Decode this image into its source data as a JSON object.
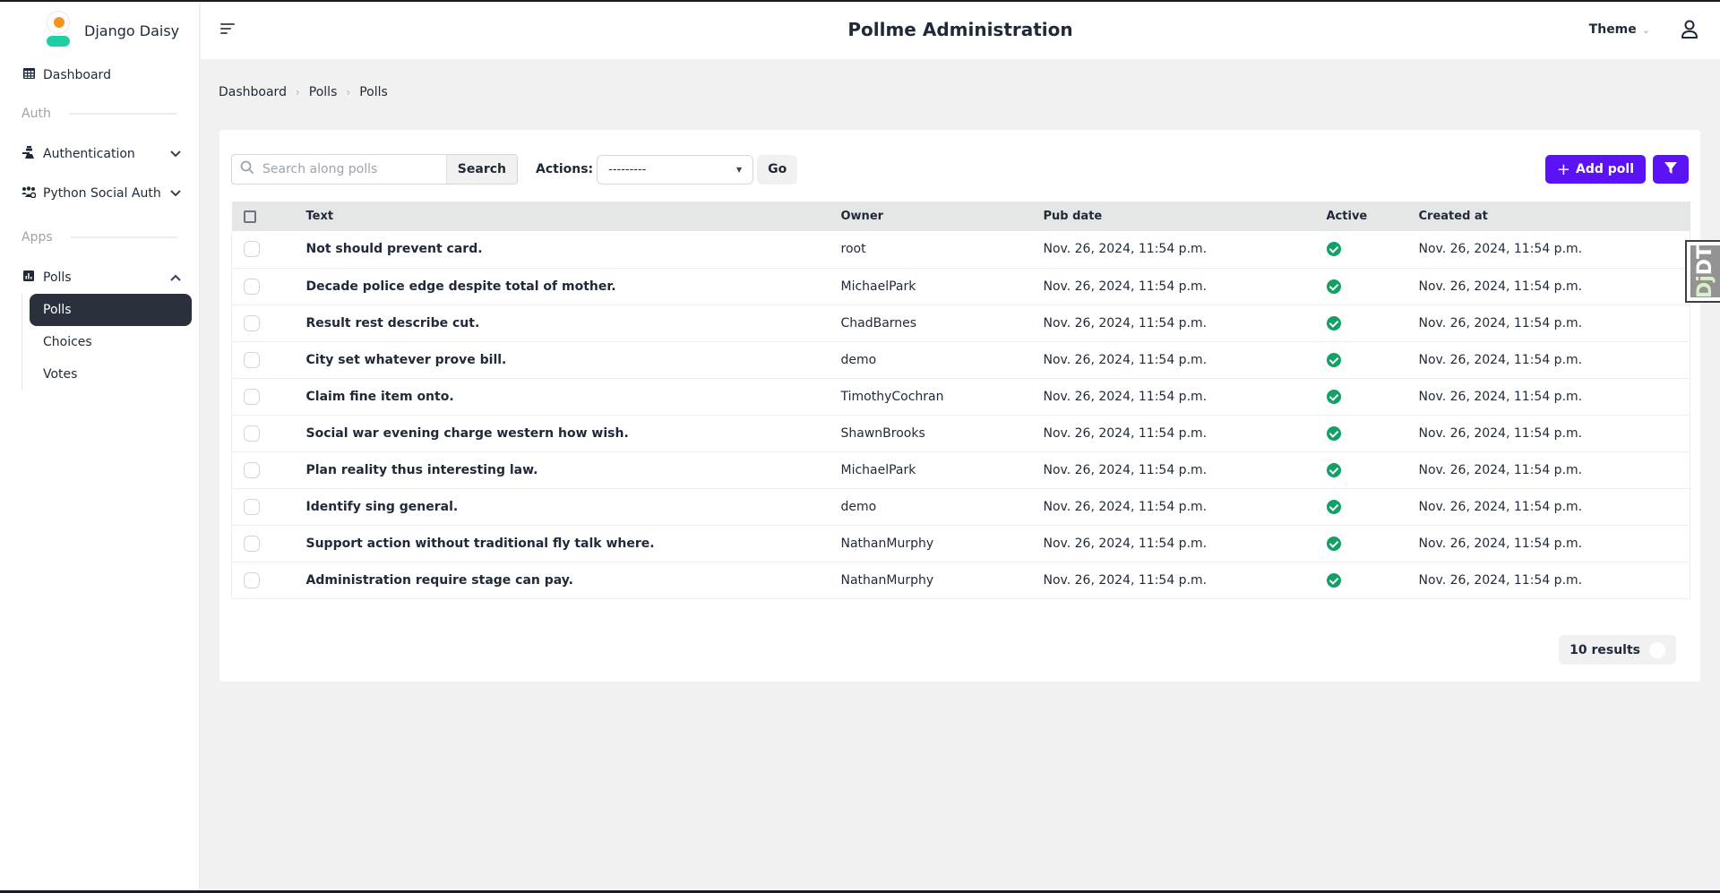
{
  "brand": {
    "name": "Django Daisy",
    "logo_colors": {
      "head": "#f7941d",
      "body": "#1dcfa3"
    }
  },
  "sidebar": {
    "dashboard": {
      "label": "Dashboard",
      "icon": "table-icon"
    },
    "sections": [
      {
        "title": "Auth",
        "items": [
          {
            "label": "Authentication",
            "icon": "user-shield-icon",
            "expanded": false
          },
          {
            "label": "Python Social Auth",
            "icon": "users-gear-icon",
            "expanded": false
          }
        ]
      },
      {
        "title": "Apps",
        "items": [
          {
            "label": "Polls",
            "icon": "chart-icon",
            "expanded": true,
            "children": [
              {
                "label": "Polls",
                "active": true
              },
              {
                "label": "Choices",
                "active": false
              },
              {
                "label": "Votes",
                "active": false
              }
            ]
          }
        ]
      }
    ]
  },
  "header": {
    "title": "Pollme Administration",
    "theme_label": "Theme"
  },
  "breadcrumb": [
    "Dashboard",
    "Polls",
    "Polls"
  ],
  "toolbar": {
    "search_placeholder": "Search along polls",
    "search_value": "",
    "search_button": "Search",
    "actions_label": "Actions:",
    "actions_selected": "---------",
    "go_button": "Go",
    "add_button": "Add poll",
    "accent_color": "#5b12f5"
  },
  "table": {
    "columns": [
      "Text",
      "Owner",
      "Pub date",
      "Active",
      "Created at"
    ],
    "rows": [
      {
        "text": "Not should prevent card.",
        "owner": "root",
        "pub_date": "Nov. 26, 2024, 11:54 p.m.",
        "active": true,
        "created_at": "Nov. 26, 2024, 11:54 p.m."
      },
      {
        "text": "Decade police edge despite total of mother.",
        "owner": "MichaelPark",
        "pub_date": "Nov. 26, 2024, 11:54 p.m.",
        "active": true,
        "created_at": "Nov. 26, 2024, 11:54 p.m."
      },
      {
        "text": "Result rest describe cut.",
        "owner": "ChadBarnes",
        "pub_date": "Nov. 26, 2024, 11:54 p.m.",
        "active": true,
        "created_at": "Nov. 26, 2024, 11:54 p.m."
      },
      {
        "text": "City set whatever prove bill.",
        "owner": "demo",
        "pub_date": "Nov. 26, 2024, 11:54 p.m.",
        "active": true,
        "created_at": "Nov. 26, 2024, 11:54 p.m."
      },
      {
        "text": "Claim fine item onto.",
        "owner": "TimothyCochran",
        "pub_date": "Nov. 26, 2024, 11:54 p.m.",
        "active": true,
        "created_at": "Nov. 26, 2024, 11:54 p.m."
      },
      {
        "text": "Social war evening charge western how wish.",
        "owner": "ShawnBrooks",
        "pub_date": "Nov. 26, 2024, 11:54 p.m.",
        "active": true,
        "created_at": "Nov. 26, 2024, 11:54 p.m."
      },
      {
        "text": "Plan reality thus interesting law.",
        "owner": "MichaelPark",
        "pub_date": "Nov. 26, 2024, 11:54 p.m.",
        "active": true,
        "created_at": "Nov. 26, 2024, 11:54 p.m."
      },
      {
        "text": "Identify sing general.",
        "owner": "demo",
        "pub_date": "Nov. 26, 2024, 11:54 p.m.",
        "active": true,
        "created_at": "Nov. 26, 2024, 11:54 p.m."
      },
      {
        "text": "Support action without traditional fly talk where.",
        "owner": "NathanMurphy",
        "pub_date": "Nov. 26, 2024, 11:54 p.m.",
        "active": true,
        "created_at": "Nov. 26, 2024, 11:54 p.m."
      },
      {
        "text": "Administration require stage can pay.",
        "owner": "NathanMurphy",
        "pub_date": "Nov. 26, 2024, 11:54 p.m.",
        "active": true,
        "created_at": "Nov. 26, 2024, 11:54 p.m."
      }
    ]
  },
  "results": {
    "label": "10 results"
  },
  "debug_toolbar": {
    "label_dj": "Dj",
    "label_dt": "DT"
  }
}
